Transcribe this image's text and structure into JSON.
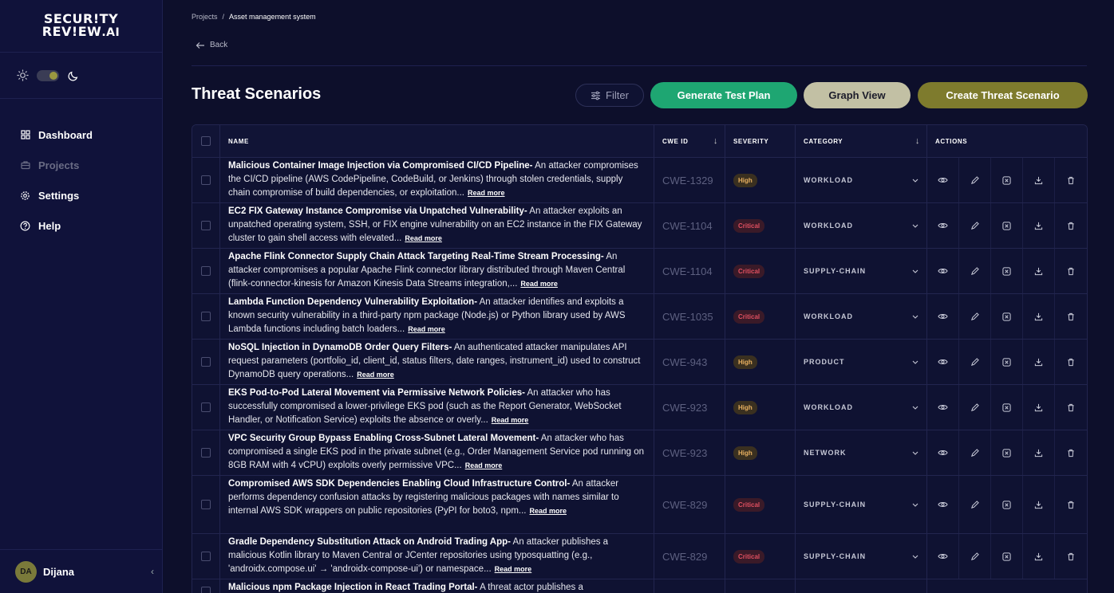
{
  "sidebar": {
    "logo_line1": "SECUR!TY",
    "logo_line2": "REV!EW",
    "logo_suffix": ".AI",
    "nav": [
      {
        "label": "Dashboard",
        "icon": "grid-icon",
        "active": false
      },
      {
        "label": "Projects",
        "icon": "briefcase-icon",
        "active": true
      },
      {
        "label": "Settings",
        "icon": "gear-icon",
        "active": false
      },
      {
        "label": "Help",
        "icon": "help-circle-icon",
        "active": false
      }
    ],
    "user": {
      "initials": "DA",
      "name": "Dijana"
    }
  },
  "breadcrumb": {
    "root": "Projects",
    "separator": "/",
    "current": "Asset management system"
  },
  "back_label": "Back",
  "page_title": "Threat Scenarios",
  "toolbar": {
    "filter_label": "Filter",
    "generate_label": "Generate Test Plan",
    "graph_label": "Graph View",
    "create_label": "Create Threat Scenario"
  },
  "colors": {
    "generate": "#1ea672",
    "graph": "#c2c0a4",
    "create": "#7e7b2d",
    "high": "#e8b060",
    "critical": "#e05060"
  },
  "table": {
    "headers": {
      "name": "NAME",
      "cwe": "CWE ID",
      "severity": "SEVERITY",
      "category": "CATEGORY",
      "actions": "ACTIONS"
    },
    "read_more": "Read more",
    "rows": [
      {
        "title": "Malicious Container Image Injection via Compromised CI/CD Pipeline-",
        "desc": "An attacker compromises the CI/CD pipeline (AWS CodePipeline, CodeBuild, or Jenkins) through stolen credentials, supply chain compromise of build dependencies, or exploitation...",
        "cwe": "CWE-1329",
        "severity": "High",
        "category": "WORKLOAD"
      },
      {
        "title": "EC2 FIX Gateway Instance Compromise via Unpatched Vulnerability-",
        "desc": "An attacker exploits an unpatched operating system, SSH, or FIX engine vulnerability on an EC2 instance in the FIX Gateway cluster to gain shell access with elevated...",
        "cwe": "CWE-1104",
        "severity": "Critical",
        "category": "WORKLOAD"
      },
      {
        "title": "Apache Flink Connector Supply Chain Attack Targeting Real-Time Stream Processing-",
        "desc": "An attacker compromises a popular Apache Flink connector library distributed through Maven Central (flink-connector-kinesis for Amazon Kinesis Data Streams integration,...",
        "cwe": "CWE-1104",
        "severity": "Critical",
        "category": "SUPPLY-CHAIN"
      },
      {
        "title": "Lambda Function Dependency Vulnerability Exploitation-",
        "desc": "An attacker identifies and exploits a known security vulnerability in a third-party npm package (Node.js) or Python library used by AWS Lambda functions including batch loaders...",
        "cwe": "CWE-1035",
        "severity": "Critical",
        "category": "WORKLOAD"
      },
      {
        "title": "NoSQL Injection in DynamoDB Order Query Filters-",
        "desc": "An authenticated attacker manipulates API request parameters (portfolio_id, client_id, status filters, date ranges, instrument_id) used to construct DynamoDB query operations...",
        "cwe": "CWE-943",
        "severity": "High",
        "category": "PRODUCT"
      },
      {
        "title": "EKS Pod-to-Pod Lateral Movement via Permissive Network Policies-",
        "desc": "An attacker who has successfully compromised a lower-privilege EKS pod (such as the Report Generator, WebSocket Handler, or Notification Service) exploits the absence or overly...",
        "cwe": "CWE-923",
        "severity": "High",
        "category": "WORKLOAD"
      },
      {
        "title": "VPC Security Group Bypass Enabling Cross-Subnet Lateral Movement-",
        "desc": "An attacker who has compromised a single EKS pod in the private subnet (e.g., Order Management Service pod running on 8GB RAM with 4 vCPU) exploits overly permissive VPC...",
        "cwe": "CWE-923",
        "severity": "High",
        "category": "NETWORK"
      },
      {
        "title": "Compromised AWS SDK Dependencies Enabling Cloud Infrastructure Control-",
        "desc": "An attacker performs dependency confusion attacks by registering malicious packages with names similar to internal AWS SDK wrappers on public repositories (PyPI for boto3, npm...",
        "cwe": "CWE-829",
        "severity": "Critical",
        "category": "SUPPLY-CHAIN"
      },
      {
        "title": "Gradle Dependency Substitution Attack on Android Trading App-",
        "desc": "An attacker publishes a malicious Kotlin library to Maven Central or JCenter repositories using typosquatting (e.g., 'androidx.compose.ui' → 'androidx-compose-ui') or namespace...",
        "cwe": "CWE-829",
        "severity": "Critical",
        "category": "SUPPLY-CHAIN"
      },
      {
        "title": "Malicious npm Package Injection in React Trading Portal-",
        "desc": "A threat actor publishes a",
        "cwe": "",
        "severity": "",
        "category": ""
      }
    ]
  }
}
